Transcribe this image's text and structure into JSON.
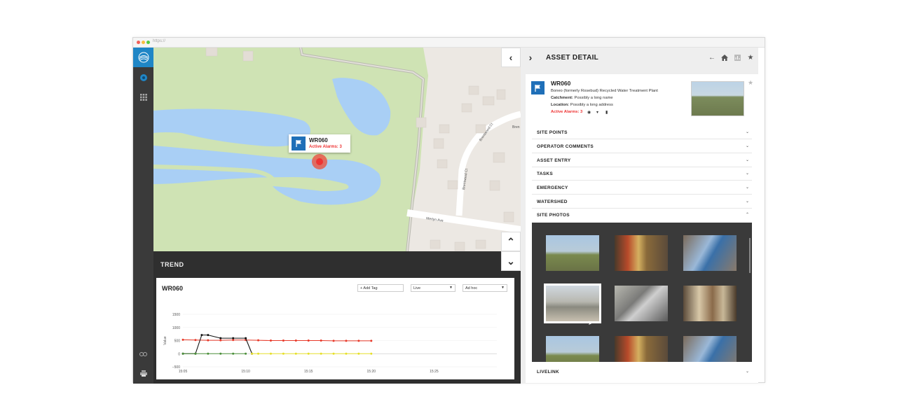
{
  "browser": {
    "url": "https://"
  },
  "map": {
    "labels": {
      "street1": "Brentwood Ct",
      "street2": "Brentwood Ct",
      "street3": "Merlyn Ave",
      "street4": "Bren"
    },
    "popup": {
      "name": "WR060",
      "alarms": "Active Alarms: 3"
    }
  },
  "trend": {
    "header": "TREND",
    "title": "WR060",
    "add_tag": "+ Add Tag",
    "mode": "Live",
    "range": "Ad hoc"
  },
  "chart_data": {
    "type": "line",
    "ylabel": "Value",
    "yticks": [
      "1500",
      "1000",
      "500",
      "0",
      "−500"
    ],
    "xticks": [
      "15:05",
      "15:10",
      "15:15",
      "15:20",
      "15:25"
    ],
    "ylim": [
      -500,
      1500
    ],
    "x_minutes": [
      15.05,
      15.25
    ],
    "series": [
      {
        "color": "#e83a2a",
        "x": [
          "15:05",
          "15:06",
          "15:07",
          "15:08",
          "15:09",
          "15:10",
          "15:11",
          "15:12",
          "15:13",
          "15:14",
          "15:15",
          "15:16",
          "15:17",
          "15:18",
          "15:19",
          "15:20"
        ],
        "values": [
          530,
          520,
          510,
          510,
          520,
          520,
          510,
          500,
          500,
          500,
          500,
          500,
          490,
          490,
          490,
          490
        ]
      },
      {
        "color": "#111111",
        "x": [
          "15:05",
          "15:06",
          "15:06.5",
          "15:07",
          "15:08",
          "15:09",
          "15:10",
          "15:10.5"
        ],
        "values": [
          0,
          0,
          710,
          710,
          590,
          590,
          590,
          0
        ]
      },
      {
        "color": "#e6df2a",
        "x": [
          "15:10.5",
          "15:11",
          "15:12",
          "15:13",
          "15:14",
          "15:15",
          "15:16",
          "15:17",
          "15:18",
          "15:19",
          "15:20"
        ],
        "values": [
          0,
          0,
          0,
          0,
          0,
          0,
          0,
          0,
          0,
          0,
          0
        ]
      },
      {
        "color": "#4b8f3a",
        "x": [
          "15:05",
          "15:06",
          "15:07",
          "15:08",
          "15:09",
          "15:10"
        ],
        "values": [
          0,
          0,
          0,
          0,
          0,
          0
        ]
      }
    ]
  },
  "detail": {
    "title": "ASSET DETAIL",
    "asset": {
      "name": "WR060",
      "description": "Boneo (formerly Rosebud) Recycled Water Treatment Plant",
      "catchment_label": "Catchment:",
      "catchment_value": "Possibly a long name",
      "location_label": "Location:",
      "location_value": "Possibly a long address",
      "alarms": "Active Alarms: 3"
    },
    "sections": [
      {
        "label": "SITE POINTS",
        "chevron": "⌄"
      },
      {
        "label": "OPERATOR COMMENTS",
        "chevron": "⌄"
      },
      {
        "label": "ASSET ENTRY",
        "chevron": "⌄"
      },
      {
        "label": "TASKS",
        "chevron": "⌄"
      },
      {
        "label": "EMERGENCY",
        "chevron": "⌄"
      },
      {
        "label": "WATERSHED",
        "chevron": "⌄"
      },
      {
        "label": "SITE PHOTOS",
        "chevron": "⌃"
      }
    ],
    "footer_section": {
      "label": "LIVELINK",
      "chevron": "⌄"
    }
  },
  "colors": {
    "accent": "#1f86c6",
    "alarm": "#e33333",
    "water": "#a9cff5",
    "park": "#cfe3b4"
  }
}
